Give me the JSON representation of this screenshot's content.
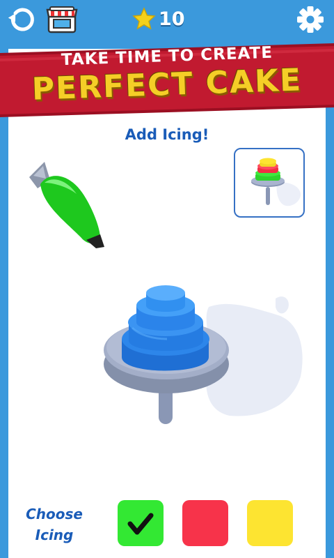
{
  "header": {
    "star_count": "10",
    "icons": [
      "restart-icon",
      "shop-icon",
      "star-icon",
      "gear-icon"
    ]
  },
  "banner": {
    "line1": "TAKE TIME TO CREATE",
    "line2": "PERFECT CAKE"
  },
  "instruction": "Add Icing!",
  "choose_label": "Choose\nIcing",
  "swatches": [
    {
      "color": "#33e833",
      "selected": true
    },
    {
      "color": "#f7334a",
      "selected": false
    },
    {
      "color": "#fde431",
      "selected": false
    }
  ],
  "colors": {
    "background": "#3b99dc",
    "banner": "#b8142a",
    "icing_bag": "#22d022",
    "cake": "#2d86ea"
  }
}
